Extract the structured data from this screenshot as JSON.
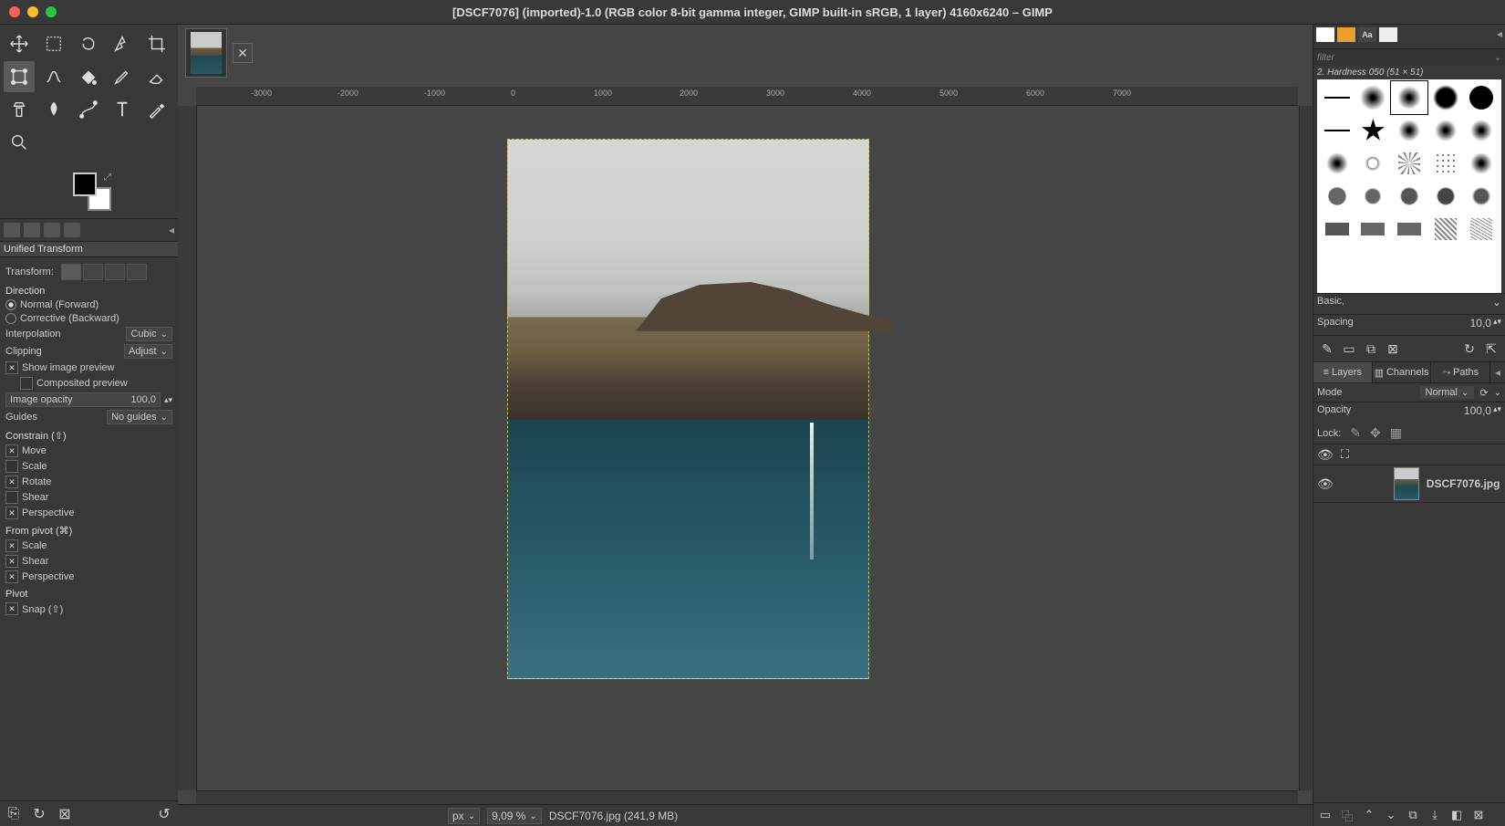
{
  "titlebar": {
    "title": "[DSCF7076] (imported)-1.0 (RGB color 8-bit gamma integer, GIMP built-in sRGB, 1 layer) 4160x6240 – GIMP"
  },
  "tool_options": {
    "header": "Unified Transform",
    "transform_label": "Transform:",
    "direction_label": "Direction",
    "direction_normal": "Normal (Forward)",
    "direction_corrective": "Corrective (Backward)",
    "interpolation_label": "Interpolation",
    "interpolation_value": "Cubic",
    "clipping_label": "Clipping",
    "clipping_value": "Adjust",
    "show_preview": "Show image preview",
    "composited": "Composited preview",
    "image_opacity_label": "Image opacity",
    "image_opacity_value": "100,0",
    "guides_label": "Guides",
    "guides_value": "No guides",
    "constrain_label": "Constrain (⇧)",
    "move": "Move",
    "scale": "Scale",
    "rotate": "Rotate",
    "shear": "Shear",
    "perspective": "Perspective",
    "from_pivot_label": "From pivot  (⌘)",
    "pivot_label": "Pivot",
    "snap": "Snap (⇧)"
  },
  "ruler": {
    "marks": [
      "-3000",
      "-2000",
      "-1000",
      "0",
      "1000",
      "2000",
      "3000",
      "4000",
      "5000",
      "6000",
      "7000"
    ]
  },
  "status": {
    "unit": "px",
    "zoom": "9,09 %",
    "file": "DSCF7076.jpg (241,9 MB)"
  },
  "brushes": {
    "filter_placeholder": "filter",
    "selected_label": "2. Hardness 050 (51 × 51)",
    "preset_label": "Basic,",
    "spacing_label": "Spacing",
    "spacing_value": "10,0"
  },
  "panels": {
    "layers": "Layers",
    "channels": "Channels",
    "paths": "Paths"
  },
  "layer": {
    "mode_label": "Mode",
    "mode_value": "Normal",
    "opacity_label": "Opacity",
    "opacity_value": "100,0",
    "lock_label": "Lock:",
    "name": "DSCF7076.jpg"
  }
}
